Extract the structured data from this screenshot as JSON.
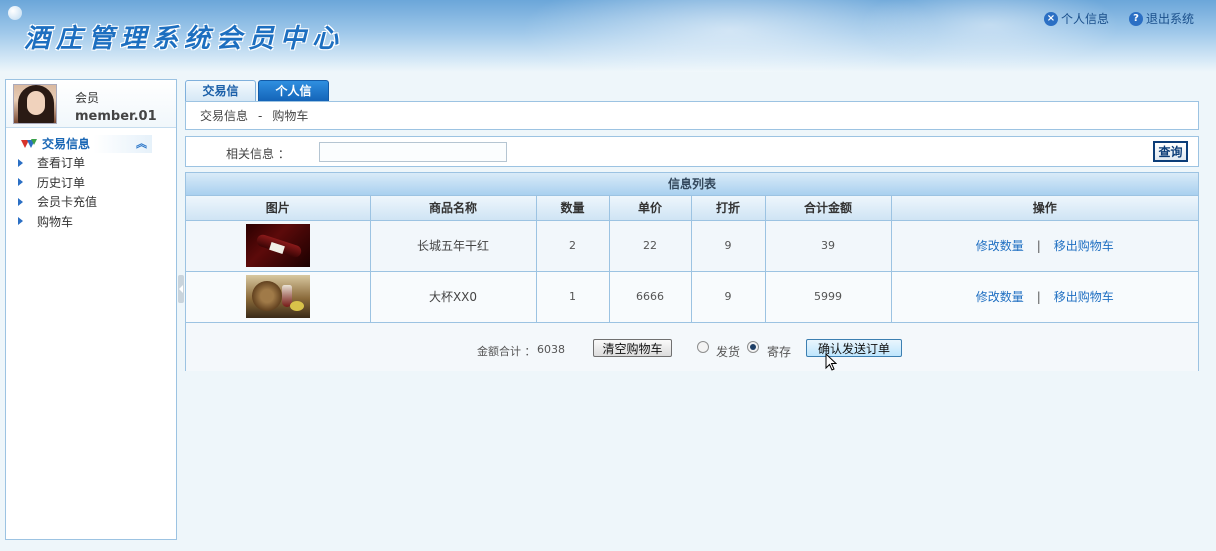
{
  "header": {
    "title": "酒庄管理系统会员中心",
    "links": [
      {
        "icon": "close-circle-icon",
        "label": "个人信息"
      },
      {
        "icon": "help-circle-icon",
        "label": "退出系统"
      }
    ]
  },
  "sidebar": {
    "user": {
      "role": "会员",
      "name": "member.01"
    },
    "menu_title": "交易信息",
    "items": [
      {
        "label": "查看订单"
      },
      {
        "label": "历史订单"
      },
      {
        "label": "会员卡充值"
      },
      {
        "label": "购物车"
      }
    ]
  },
  "tabs": [
    {
      "label": "交易信息",
      "active": true
    },
    {
      "label": "个人信息",
      "active": false
    }
  ],
  "breadcrumb": {
    "section": "交易信息",
    "separator": "-",
    "page": "购物车"
  },
  "search": {
    "label": "相关信息 ：",
    "value": "",
    "button": "查询"
  },
  "list": {
    "title": "信息列表",
    "columns": [
      "图片",
      "商品名称",
      "数量",
      "单价",
      "打折",
      "合计金额",
      "操作"
    ],
    "rows": [
      {
        "image": "wine-bottle-image",
        "name": "长城五年干红",
        "qty": "2",
        "price": "22",
        "discount": "9",
        "total": "39",
        "actions": {
          "edit": "修改数量",
          "sep": "|",
          "remove": "移出购物车"
        }
      },
      {
        "image": "wine-glass-image",
        "name": "大杯XX0",
        "qty": "1",
        "price": "6666",
        "discount": "9",
        "total": "5999",
        "actions": {
          "edit": "修改数量",
          "sep": "|",
          "remove": "移出购物车"
        }
      }
    ],
    "footer": {
      "total_label": "金额合计 ：",
      "total_value": "6038",
      "clear_button": "清空购物车",
      "radio_ship": "发货",
      "radio_store": "寄存",
      "selected": "寄存",
      "confirm_button": "确认发送订单"
    }
  },
  "colors": {
    "accent": "#1a67b5",
    "border": "#9cc3e2",
    "tab_active_bg": "#1464b8"
  }
}
